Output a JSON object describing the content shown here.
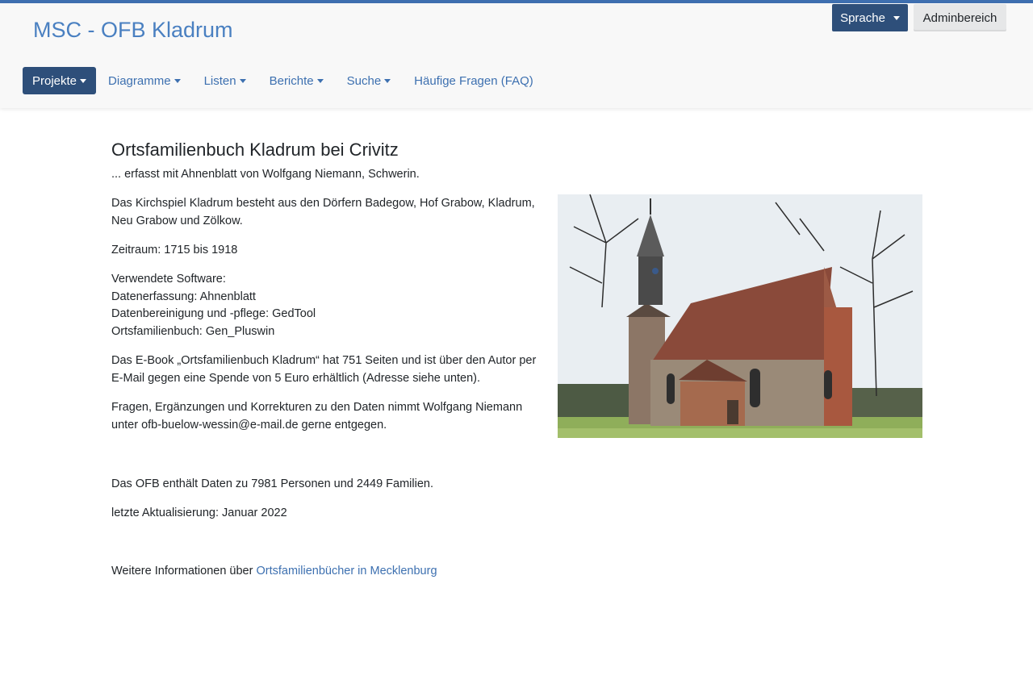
{
  "header": {
    "site_title": "MSC - OFB Kladrum",
    "language_button": "Sprache",
    "admin_button": "Adminbereich"
  },
  "nav": {
    "items": [
      {
        "label": "Projekte",
        "dropdown": true,
        "active": true
      },
      {
        "label": "Diagramme",
        "dropdown": true
      },
      {
        "label": "Listen",
        "dropdown": true
      },
      {
        "label": "Berichte",
        "dropdown": true
      },
      {
        "label": "Suche",
        "dropdown": true
      },
      {
        "label": "Häufige Fragen (FAQ)",
        "dropdown": false
      }
    ]
  },
  "main": {
    "heading": "Ortsfamilienbuch Kladrum bei Crivitz",
    "subtitle": "... erfasst mit Ahnenblatt von Wolfgang Niemann, Schwerin.",
    "p_villages_1": "Das Kirchspiel Kladrum besteht aus den Dörfern Badegow, Hof Grabow, Kladrum,",
    "p_villages_2": "Neu Grabow und Zölkow.",
    "period": "Zeitraum: 1715 bis 1918",
    "software_title": "Verwendete Software:",
    "software_1": "Datenerfassung: Ahnenblatt",
    "software_2": "Datenbereinigung und -pflege: GedTool",
    "software_3": "Ortsfamilienbuch: Gen_Pluswin",
    "ebook_1": "Das E-Book „Ortsfamilienbuch Kladrum“ hat 751 Seiten und ist über den Autor per",
    "ebook_2": "E-Mail gegen eine Spende von 5 Euro erhältlich (Adresse siehe unten).",
    "contact_1": "Fragen, Ergänzungen und Korrekturen zu den Daten nimmt Wolfgang Niemann",
    "contact_2": "unter ofb-buelow-wessin@e-mail.de gerne entgegen.",
    "stats": "Das OFB enthält Daten zu 7981 Personen und 2449 Familien.",
    "last_update": "letzte Aktualisierung: Januar 2022",
    "more_info_prefix": "Weitere Informationen über ",
    "more_info_link": "Ortsfamilienbücher in Mecklenburg"
  },
  "colors": {
    "accent": "#4a80c1",
    "nav_active": "#2e4f7a",
    "link": "#3d70b0"
  }
}
